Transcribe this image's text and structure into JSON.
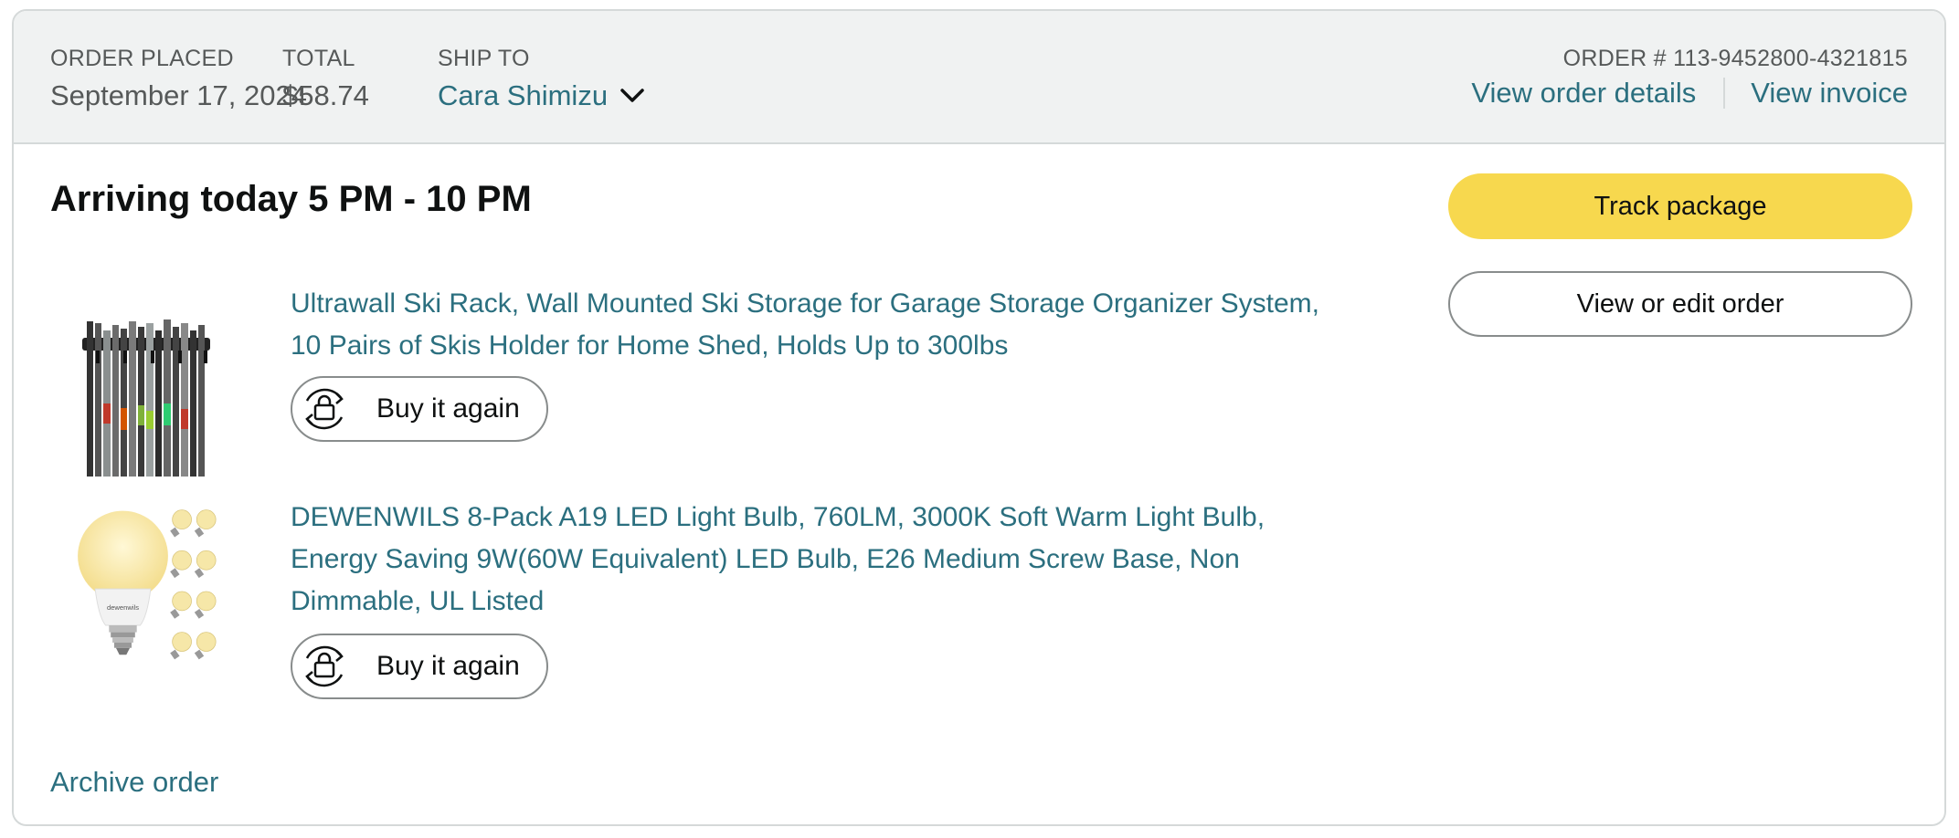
{
  "header": {
    "order_placed_label": "ORDER PLACED",
    "order_placed_value": "September 17, 2024",
    "total_label": "TOTAL",
    "total_value": "$58.74",
    "ship_to_label": "SHIP TO",
    "ship_to_name": "Cara Shimizu",
    "order_number": "ORDER # 113-9452800-4321815",
    "view_order_details": "View order details",
    "view_invoice": "View invoice"
  },
  "delivery_status": "Arriving today 5 PM - 10 PM",
  "items": [
    {
      "title": "Ultrawall Ski Rack, Wall Mounted Ski Storage for Garage Storage Organizer System, 10 Pairs of Skis Holder for Home Shed, Holds Up to 300lbs",
      "buy_again_label": "Buy it again",
      "image_icon": "ski-rack-product-image"
    },
    {
      "title": "DEWENWILS 8-Pack A19 LED Light Bulb, 760LM, 3000K Soft Warm Light Bulb, Energy Saving 9W(60W Equivalent) LED Bulb, E26 Medium Screw Base, Non Dimmable, UL Listed",
      "buy_again_label": "Buy it again",
      "image_icon": "light-bulb-product-image",
      "logo_text": "dewenwils"
    }
  ],
  "actions": {
    "track_package": "Track package",
    "view_or_edit_order": "View or edit order"
  },
  "archive_order": "Archive order",
  "colors": {
    "link": "#2b6f7f",
    "header_bg": "#f0f2f2",
    "primary_button": "#f7d84e",
    "border": "#d5d9d9"
  }
}
